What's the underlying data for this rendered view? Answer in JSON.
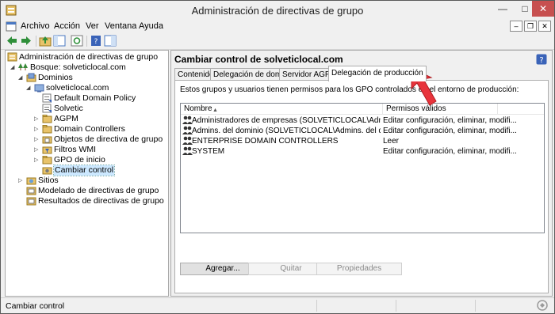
{
  "window": {
    "title": "Administración de directivas de grupo"
  },
  "menu": [
    "Archivo",
    "Acción",
    "Ver",
    "Ventana",
    "Ayuda"
  ],
  "tree": {
    "root": "Administración de directivas de grupo",
    "forest": "Bosque: solveticlocal.com",
    "domains": "Dominios",
    "domain": "solveticlocal.com",
    "children": [
      "Default Domain Policy",
      "Solvetic",
      "AGPM",
      "Domain Controllers",
      "Objetos de directiva de grupo",
      "Filtros WMI",
      "GPO de inicio",
      "Cambiar control"
    ],
    "sites": "Sitios",
    "modeling": "Modelado de directivas de grupo",
    "results": "Resultados de directivas de grupo"
  },
  "panel": {
    "title": "Cambiar control de solveticlocal.com",
    "tabs": [
      "Contenido",
      "Delegación de dominio",
      "Servidor AGPM",
      "Delegación de producción"
    ],
    "description": "Estos grupos y usuarios tienen permisos para los GPO controlados en el entorno de producción:",
    "columns": [
      "Nombre",
      "Permisos válidos"
    ],
    "rows": [
      {
        "name": "Administradores de empresas (SOLVETICLOCAL\\Administrador...",
        "perm": "Editar configuración, eliminar, modifi..."
      },
      {
        "name": "Admins. del dominio (SOLVETICLOCAL\\Admins. del dominio)",
        "perm": "Editar configuración, eliminar, modifi..."
      },
      {
        "name": "ENTERPRISE DOMAIN CONTROLLERS",
        "perm": "Leer"
      },
      {
        "name": "SYSTEM",
        "perm": "Editar configuración, eliminar, modifi..."
      }
    ],
    "buttons": {
      "add": "Agregar...",
      "remove": "Quitar",
      "properties": "Propiedades"
    }
  },
  "status": "Cambiar control",
  "colors": {
    "accent": "#e8343c",
    "selection": "#cce8ff"
  }
}
